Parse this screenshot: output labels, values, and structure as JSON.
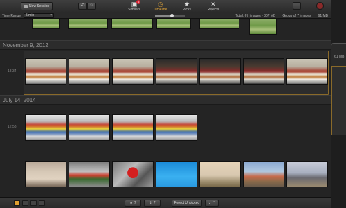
{
  "toolbar": {
    "new_session_label": "New Session",
    "modes": [
      {
        "label": "Similars",
        "badge": "6",
        "glyph": "▣"
      },
      {
        "label": "Timeline",
        "glyph": "◷"
      },
      {
        "label": "Picks",
        "glyph": "★"
      },
      {
        "label": "Rejects",
        "glyph": "✕"
      }
    ]
  },
  "rangebar": {
    "label": "Time Range:",
    "selected": "5 min",
    "zoom_level": 0.55,
    "total": "Total: 67 images - 307 MB",
    "group": "Group of 7 images",
    "group_size": "61 MB"
  },
  "background_window": {
    "size": "61 MB"
  },
  "sections": [
    {
      "date": "November 9, 2012",
      "time": "18:34"
    },
    {
      "date": "July 14, 2014",
      "time": "12:58"
    }
  ],
  "footer": {
    "picks_count": "7",
    "share_count": "7",
    "reject_label": "Reject Unpicked"
  },
  "colors": {
    "accent": "#e8a93a",
    "selection": "#8a6a2a",
    "badge": "#dd2233"
  }
}
